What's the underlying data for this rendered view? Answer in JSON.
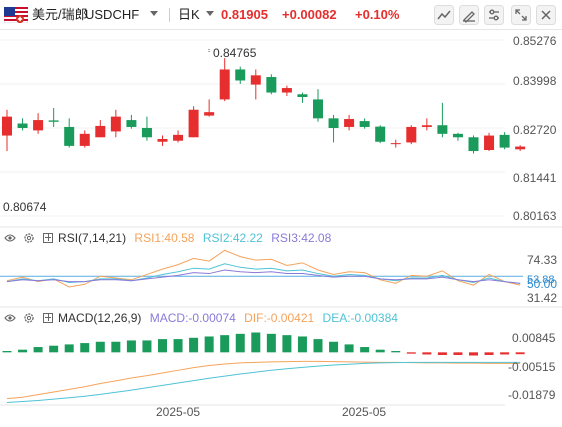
{
  "toolbar": {
    "symbol_name": "美元/瑞郎",
    "symbol_code": "USDCHF",
    "interval": "日K",
    "last_price": "0.81905",
    "change": "+0.00082",
    "change_pct": "+0.10%",
    "icons": [
      "chart-type-icon",
      "draw-tool-icon",
      "settings-icon",
      "fullscreen-icon",
      "close-icon"
    ]
  },
  "colors": {
    "up": "#e62e2e",
    "down": "#1a9b5c",
    "rsi1": "#f5a35b",
    "rsi2": "#4fc3d6",
    "rsi3": "#8a7ad8",
    "dif": "#f5a35b",
    "dea": "#4fc3d6",
    "line50": "#5aaee0"
  },
  "price_axis": {
    "labels": [
      "0.85276",
      "0.83998",
      "0.82720",
      "0.81441",
      "0.80163"
    ]
  },
  "price_annotations": {
    "high": "0.84765",
    "low": "0.80674"
  },
  "rsi": {
    "title": "RSI(7,14,21)",
    "rsi1": "RSI1:40.58",
    "rsi2": "RSI2:42.22",
    "rsi3": "RSI3:42.08",
    "axis_labels": [
      "74.33",
      "50.00",
      "31.42"
    ],
    "axis_tag": "53.88"
  },
  "macd": {
    "title": "MACD(12,26,9)",
    "macd": "MACD:-0.00074",
    "dif": "DIF:-0.00421",
    "dea": "DEA:-0.00384",
    "axis_labels": [
      "0.00845",
      "-0.00515",
      "-0.01879"
    ]
  },
  "time_axis": {
    "labels": [
      "2025-05",
      "2025-05"
    ]
  },
  "chart_data": {
    "type": "candlestick",
    "title": "USDCHF 日K",
    "ylim": [
      0.80163,
      0.85276
    ],
    "candles": [
      {
        "o": 0.825,
        "h": 0.8325,
        "l": 0.8205,
        "c": 0.8305
      },
      {
        "o": 0.8285,
        "h": 0.83,
        "l": 0.8265,
        "c": 0.8272
      },
      {
        "o": 0.8265,
        "h": 0.8315,
        "l": 0.8255,
        "c": 0.8295
      },
      {
        "o": 0.8294,
        "h": 0.833,
        "l": 0.8275,
        "c": 0.829
      },
      {
        "o": 0.8275,
        "h": 0.83,
        "l": 0.8215,
        "c": 0.822
      },
      {
        "o": 0.822,
        "h": 0.8265,
        "l": 0.8215,
        "c": 0.8255
      },
      {
        "o": 0.8245,
        "h": 0.8295,
        "l": 0.8245,
        "c": 0.8278
      },
      {
        "o": 0.8262,
        "h": 0.8325,
        "l": 0.8245,
        "c": 0.8305
      },
      {
        "o": 0.8295,
        "h": 0.831,
        "l": 0.827,
        "c": 0.8275
      },
      {
        "o": 0.8272,
        "h": 0.8305,
        "l": 0.8235,
        "c": 0.8245
      },
      {
        "o": 0.8232,
        "h": 0.825,
        "l": 0.822,
        "c": 0.824
      },
      {
        "o": 0.8235,
        "h": 0.8265,
        "l": 0.823,
        "c": 0.8252
      },
      {
        "o": 0.8245,
        "h": 0.8335,
        "l": 0.8245,
        "c": 0.8325
      },
      {
        "o": 0.8308,
        "h": 0.8355,
        "l": 0.8305,
        "c": 0.8318
      },
      {
        "o": 0.8355,
        "h": 0.8475,
        "l": 0.835,
        "c": 0.8442
      },
      {
        "o": 0.8442,
        "h": 0.845,
        "l": 0.84,
        "c": 0.841
      },
      {
        "o": 0.8398,
        "h": 0.8442,
        "l": 0.8355,
        "c": 0.8425
      },
      {
        "o": 0.842,
        "h": 0.8428,
        "l": 0.837,
        "c": 0.8375
      },
      {
        "o": 0.8375,
        "h": 0.8395,
        "l": 0.8365,
        "c": 0.8388
      },
      {
        "o": 0.837,
        "h": 0.8375,
        "l": 0.8345,
        "c": 0.8362
      },
      {
        "o": 0.8355,
        "h": 0.8385,
        "l": 0.829,
        "c": 0.83
      },
      {
        "o": 0.83,
        "h": 0.831,
        "l": 0.823,
        "c": 0.8272
      },
      {
        "o": 0.8275,
        "h": 0.831,
        "l": 0.8265,
        "c": 0.8298
      },
      {
        "o": 0.8292,
        "h": 0.83,
        "l": 0.827,
        "c": 0.8275
      },
      {
        "o": 0.8276,
        "h": 0.828,
        "l": 0.8228,
        "c": 0.8232
      },
      {
        "o": 0.8225,
        "h": 0.8238,
        "l": 0.8215,
        "c": 0.8228
      },
      {
        "o": 0.823,
        "h": 0.828,
        "l": 0.8225,
        "c": 0.8275
      },
      {
        "o": 0.8275,
        "h": 0.83,
        "l": 0.8265,
        "c": 0.828
      },
      {
        "o": 0.828,
        "h": 0.8345,
        "l": 0.8245,
        "c": 0.8255
      },
      {
        "o": 0.8255,
        "h": 0.8258,
        "l": 0.8235,
        "c": 0.8245
      },
      {
        "o": 0.8245,
        "h": 0.825,
        "l": 0.8198,
        "c": 0.8205
      },
      {
        "o": 0.8208,
        "h": 0.8258,
        "l": 0.8205,
        "c": 0.825
      },
      {
        "o": 0.8252,
        "h": 0.826,
        "l": 0.821,
        "c": 0.8215
      },
      {
        "o": 0.821,
        "h": 0.8222,
        "l": 0.8205,
        "c": 0.8218
      }
    ],
    "rsi_series": [
      {
        "name": "RSI1",
        "values": [
          45,
          49,
          44,
          47,
          38,
          41,
          50,
          48,
          46,
          52,
          58,
          63,
          70,
          67,
          79,
          72,
          68,
          69,
          62,
          65,
          57,
          52,
          55,
          54,
          46,
          42,
          51,
          50,
          56,
          45,
          40,
          52,
          44,
          40
        ]
      },
      {
        "name": "RSI2",
        "values": [
          44,
          47,
          45,
          47,
          43,
          44,
          47,
          47,
          45,
          48,
          52,
          55,
          59,
          58,
          64,
          60,
          58,
          59,
          56,
          57,
          53,
          50,
          52,
          51,
          47,
          45,
          48,
          48,
          51,
          46,
          43,
          48,
          44,
          42
        ]
      },
      {
        "name": "RSI3",
        "values": [
          44,
          46,
          45,
          46,
          44,
          44,
          46,
          46,
          45,
          47,
          49,
          51,
          54,
          53,
          57,
          55,
          54,
          55,
          53,
          53,
          51,
          49,
          50,
          50,
          47,
          46,
          47,
          47,
          49,
          46,
          44,
          46,
          44,
          42
        ]
      }
    ],
    "macd_hist": [
      0.0005,
      0.001,
      0.002,
      0.0025,
      0.003,
      0.0035,
      0.004,
      0.004,
      0.0045,
      0.0045,
      0.005,
      0.005,
      0.0055,
      0.006,
      0.0065,
      0.007,
      0.0075,
      0.007,
      0.0065,
      0.006,
      0.005,
      0.004,
      0.003,
      0.002,
      0.001,
      0.0005,
      -0.0005,
      -0.0008,
      -0.001,
      -0.001,
      -0.0012,
      -0.001,
      -0.0008,
      -0.0007
    ],
    "dif": [
      -0.0175,
      -0.017,
      -0.016,
      -0.015,
      -0.014,
      -0.013,
      -0.0118,
      -0.0108,
      -0.0097,
      -0.0088,
      -0.0078,
      -0.0068,
      -0.0058,
      -0.005,
      -0.0044,
      -0.004,
      -0.0038,
      -0.0036,
      -0.0035,
      -0.0034,
      -0.0034,
      -0.0035,
      -0.0036,
      -0.0037,
      -0.0038,
      -0.0038,
      -0.0039,
      -0.004,
      -0.004,
      -0.0041,
      -0.0041,
      -0.0042,
      -0.0042,
      -0.0042
    ],
    "dea": [
      -0.019,
      -0.0186,
      -0.0182,
      -0.0177,
      -0.0172,
      -0.0166,
      -0.0159,
      -0.0151,
      -0.0143,
      -0.0134,
      -0.0125,
      -0.0116,
      -0.0107,
      -0.0098,
      -0.009,
      -0.0082,
      -0.0075,
      -0.0068,
      -0.0062,
      -0.0057,
      -0.0052,
      -0.0048,
      -0.0045,
      -0.0042,
      -0.004,
      -0.0039,
      -0.0038,
      -0.0038,
      -0.0038,
      -0.0038,
      -0.0038,
      -0.0038,
      -0.0038,
      -0.0038
    ],
    "macd_ylim": [
      -0.01879,
      0.00845
    ],
    "rsi_ylim": [
      20,
      85
    ]
  }
}
